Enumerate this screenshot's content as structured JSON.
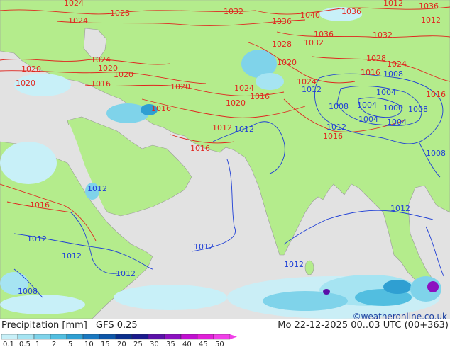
{
  "footer": {
    "title": "Precipitation [mm]",
    "model": "GFS 0.25",
    "datetime": "Mo 22-12-2025 00..03 UTC (00+363)",
    "credit": "©weatheronline.co.uk"
  },
  "legend": {
    "labels": [
      "0.1",
      "0.5",
      "1",
      "2",
      "5",
      "10",
      "15",
      "20",
      "25",
      "30",
      "35",
      "40",
      "45",
      "50"
    ],
    "colors": [
      "#c8f0f8",
      "#a6e4f2",
      "#7fd3ea",
      "#52bee0",
      "#2f9fd2",
      "#1a78c0",
      "#0d56a8",
      "#0a2f8c",
      "#1a1a8c",
      "#5a10a8",
      "#8c10c0",
      "#c010d0",
      "#e020d8",
      "#f040e8"
    ]
  },
  "colors": {
    "land": "#b4ec8c",
    "sea": "#e2e2e2",
    "high_pressure": "#e0261f",
    "low_pressure": "#1f3fd6",
    "border": "#888888"
  },
  "isobars_red": [
    "1028",
    "1032",
    "1036",
    "1040",
    "1036",
    "1036",
    "1024",
    "1036",
    "1028",
    "1032",
    "1032",
    "1028",
    "1024",
    "1024",
    "1020",
    "1020",
    "1020",
    "1016",
    "1020",
    "1024",
    "1020",
    "1016",
    "1016",
    "1012",
    "1016",
    "1016",
    "1020",
    "1020",
    "1016",
    "1016",
    "1012",
    "1012",
    "1016",
    "1024",
    "1024"
  ],
  "isobars_blue": [
    "1012",
    "1012",
    "1012",
    "1012",
    "1012",
    "1012",
    "1012",
    "1012",
    "1008",
    "1008",
    "1008",
    "1004",
    "1004",
    "1000",
    "1004",
    "1008",
    "1004",
    "1008",
    "1012",
    "1012"
  ]
}
